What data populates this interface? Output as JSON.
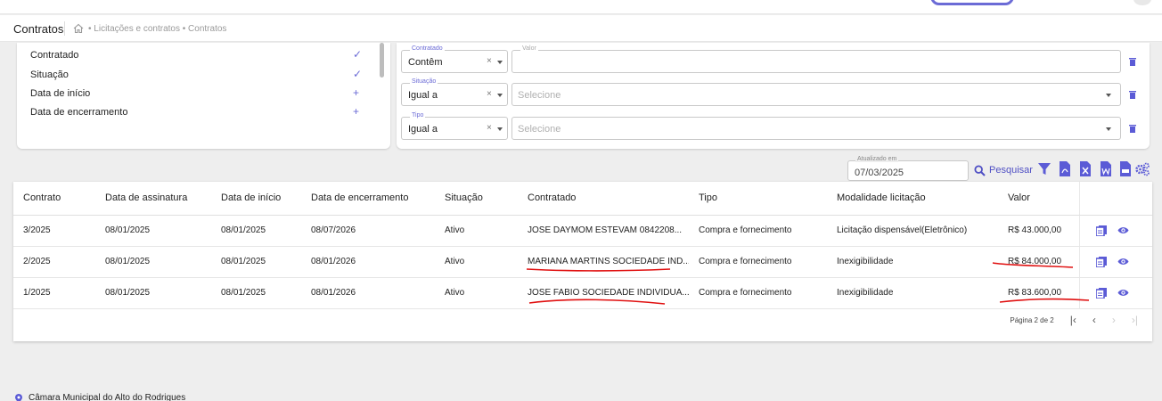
{
  "breadcrumb": {
    "title": "Contratos",
    "path": "• Licitações e contratos • Contratos"
  },
  "columns_panel": {
    "items": [
      {
        "label": "Contratado",
        "state": "✓"
      },
      {
        "label": "Situação",
        "state": "✓"
      },
      {
        "label": "Data de início",
        "state": "+"
      },
      {
        "label": "Data de encerramento",
        "state": "+"
      }
    ]
  },
  "filters": [
    {
      "field_label": "Contratado",
      "operator": "Contêm",
      "value_label": "Valor",
      "value_placeholder": ""
    },
    {
      "field_label": "Situação",
      "operator": "Igual a",
      "value_label": "",
      "value_placeholder": "Selecione"
    },
    {
      "field_label": "Tipo",
      "operator": "Igual a",
      "value_label": "",
      "value_placeholder": "Selecione"
    }
  ],
  "toolbar": {
    "updated_label": "Atualizado em",
    "updated_value": "07/03/2025",
    "search_label": "Pesquisar"
  },
  "table": {
    "headers": [
      "Contrato",
      "Data de assinatura",
      "Data de início",
      "Data de encerramento",
      "Situação",
      "Contratado",
      "Tipo",
      "Modalidade licitação",
      "Valor"
    ],
    "rows": [
      [
        "3/2025",
        "08/01/2025",
        "08/01/2025",
        "08/07/2026",
        "Ativo",
        "JOSE DAYMOM ESTEVAM 0842208...",
        "Compra e fornecimento",
        "Licitação dispensável(Eletrônico)",
        "R$ 43.000,00"
      ],
      [
        "2/2025",
        "08/01/2025",
        "08/01/2025",
        "08/01/2026",
        "Ativo",
        "MARIANA MARTINS SOCIEDADE IND...",
        "Compra e fornecimento",
        "Inexigibilidade",
        "R$ 84.000,00"
      ],
      [
        "1/2025",
        "08/01/2025",
        "08/01/2025",
        "08/01/2026",
        "Ativo",
        "JOSE FABIO SOCIEDADE INDIVIDUA...",
        "Compra e fornecimento",
        "Inexigibilidade",
        "R$ 83.600,00"
      ]
    ]
  },
  "pagination": {
    "label": "Página 2 de 2",
    "first": "|‹",
    "prev": "‹",
    "next": "›",
    "last": "›|"
  },
  "footer": {
    "text": "Câmara Municipal do Alto do Rodrigues"
  },
  "colors": {
    "accent": "#5b5bd6",
    "annotation_red": "#e01010"
  }
}
